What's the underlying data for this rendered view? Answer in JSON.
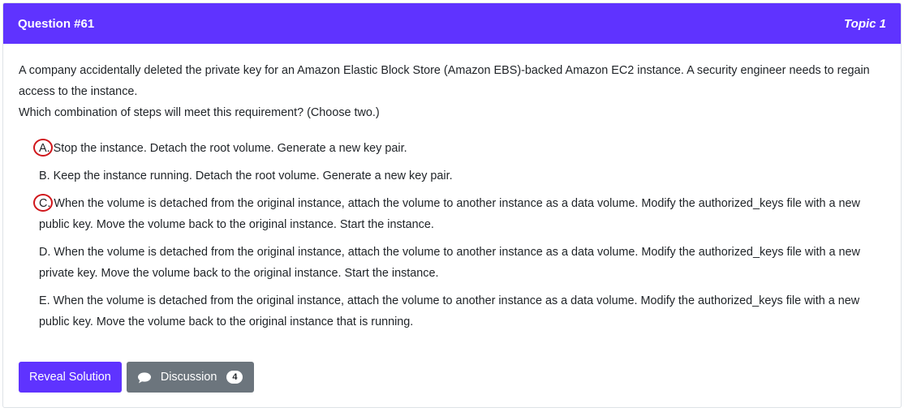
{
  "header": {
    "question_number": "Question #61",
    "topic": "Topic 1"
  },
  "question": {
    "text_line1": "A company accidentally deleted the private key for an Amazon Elastic Block Store (Amazon EBS)-backed Amazon EC2 instance. A security engineer needs to regain access to the instance.",
    "text_line2": "Which combination of steps will meet this requirement? (Choose two.)"
  },
  "choices": [
    {
      "letter": "A.",
      "text": "Stop the instance. Detach the root volume. Generate a new key pair.",
      "marked": true
    },
    {
      "letter": "B.",
      "text": "Keep the instance running. Detach the root volume. Generate a new key pair.",
      "marked": false
    },
    {
      "letter": "C.",
      "text": "When the volume is detached from the original instance, attach the volume to another instance as a data volume. Modify the authorized_keys file with a new public key. Move the volume back to the original instance. Start the instance.",
      "marked": true
    },
    {
      "letter": "D.",
      "text": "When the volume is detached from the original instance, attach the volume to another instance as a data volume. Modify the authorized_keys file with a new private key. Move the volume back to the original instance. Start the instance.",
      "marked": false
    },
    {
      "letter": "E.",
      "text": "When the volume is detached from the original instance, attach the volume to another instance as a data volume. Modify the authorized_keys file with a new public key. Move the volume back to the original instance that is running.",
      "marked": false
    }
  ],
  "buttons": {
    "reveal_label": "Reveal Solution",
    "discussion_label": "Discussion",
    "discussion_count": "4",
    "discussion_icon": "comment-icon"
  },
  "colors": {
    "accent": "#5f33ff",
    "secondary": "#6c757d",
    "mark": "#d0161b"
  }
}
